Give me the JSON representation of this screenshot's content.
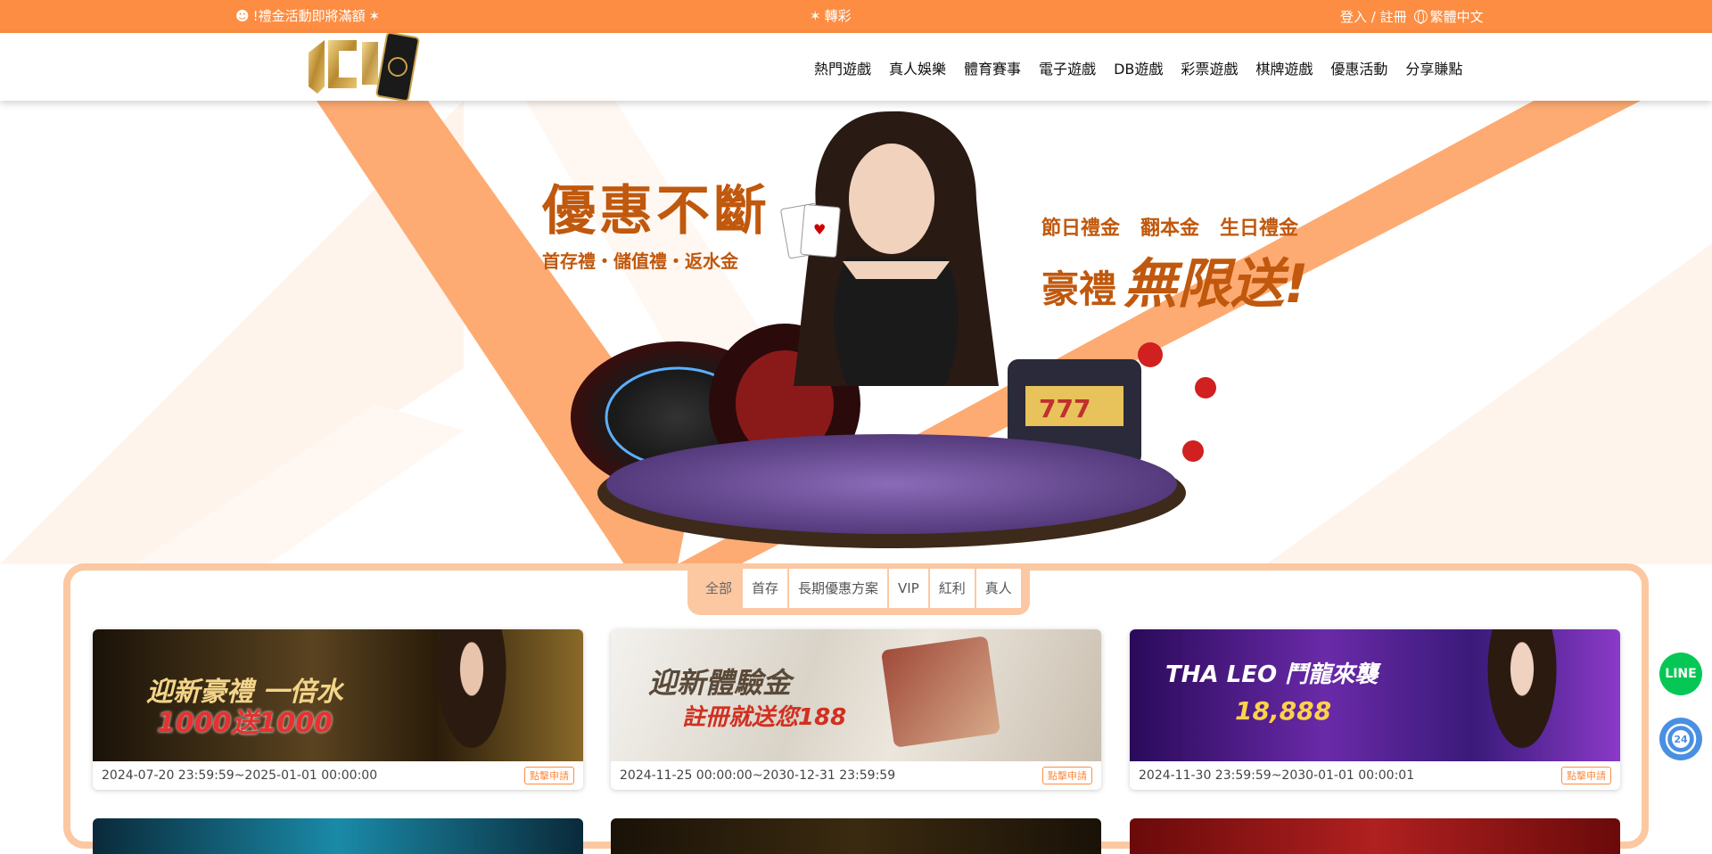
{
  "topbar": {
    "marquee_left": "!禮金活動即將滿額",
    "marquee_mid": "轉彩",
    "login": "登入 / 註冊",
    "language": "繁體中文"
  },
  "nav": {
    "items": [
      "熱門遊戲",
      "真人娛樂",
      "體育賽事",
      "電子遊戲",
      "DB遊戲",
      "彩票遊戲",
      "棋牌遊戲",
      "優惠活動",
      "分享賺點"
    ]
  },
  "hero": {
    "left_big": "優惠不斷",
    "left_small": "首存禮・儲值禮・返水金",
    "right_row1": "節日禮金   翻本金   生日禮金",
    "right_row2_a": "豪禮",
    "right_row2_b": "無限送!"
  },
  "tabs": [
    "全部",
    "首存",
    "長期優惠方案",
    "VIP",
    "紅利",
    "真人"
  ],
  "cards": [
    {
      "date": "2024-07-20 23:59:59~2025-01-01 00:00:00",
      "apply": "點擊申請",
      "title": "迎新豪禮 一倍水",
      "sub": "1000送1000"
    },
    {
      "date": "2024-11-25 00:00:00~2030-12-31 23:59:59",
      "apply": "點擊申請",
      "title": "迎新體驗金",
      "sub": "註冊就送您188"
    },
    {
      "date": "2024-11-30 23:59:59~2030-01-01 00:00:01",
      "apply": "點擊申請",
      "title": "THA LEO 鬥龍來襲",
      "sub": "18,888"
    }
  ],
  "floating": {
    "line": "LINE",
    "cs": "24"
  },
  "colors": {
    "brand_orange": "#fd8d42",
    "light_orange": "#fbc8a2",
    "hero_text": "#c0580d"
  }
}
